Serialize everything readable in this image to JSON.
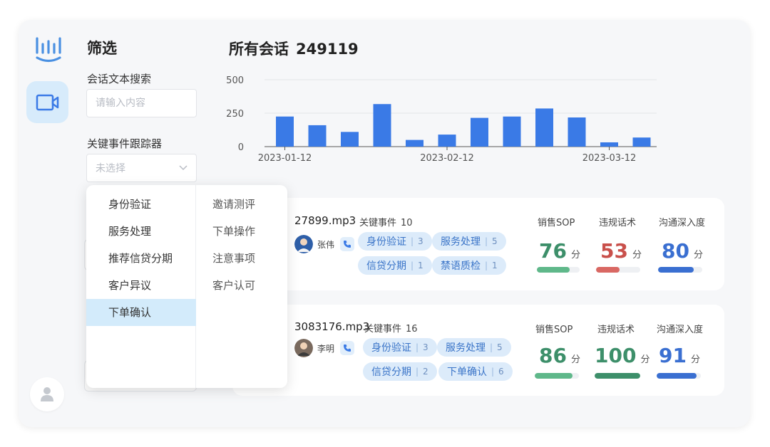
{
  "filter": {
    "title": "筛选",
    "text_search_label": "会话文本搜索",
    "text_search_placeholder": "请输入内容",
    "tracker_label": "关键事件跟踪器",
    "tracker_placeholder": "未选择"
  },
  "dropdown": {
    "col1": [
      "身份验证",
      "服务处理",
      "推荐信贷分期",
      "客户异议",
      "下单确认"
    ],
    "col1_selected": "下单确认",
    "col2": [
      "邀请测评",
      "下单操作",
      "注意事项",
      "客户认可"
    ]
  },
  "main": {
    "title": "所有会话",
    "count": "249119"
  },
  "chart_data": {
    "type": "bar",
    "values": [
      225,
      160,
      110,
      318,
      50,
      90,
      215,
      225,
      285,
      218,
      32,
      68
    ],
    "xticks": [
      "2023-01-12",
      "2023-02-12",
      "2023-03-12"
    ],
    "yticks": [
      "0",
      "250",
      "500"
    ],
    "ylim": [
      0,
      500
    ],
    "bar_color": "#3a7ae6",
    "grid": true
  },
  "cards": [
    {
      "file": "27899.mp3",
      "event_label": "关键事件",
      "event_count": "10",
      "person": "张伟",
      "tags": [
        {
          "label": "身份验证",
          "n": "3"
        },
        {
          "label": "服务处理",
          "n": "5"
        },
        {
          "label": "信贷分期",
          "n": "1"
        },
        {
          "label": "禁语质检",
          "n": "1"
        }
      ],
      "metrics": [
        {
          "name": "销售SOP",
          "score": "76",
          "unit": "分",
          "color": "#3d8f6a",
          "bar": "#5fb88a",
          "pct": 0.76
        },
        {
          "name": "违规话术",
          "score": "53",
          "unit": "分",
          "color": "#c9504b",
          "bar": "#d96863",
          "pct": 0.53
        },
        {
          "name": "沟通深入度",
          "score": "80",
          "unit": "分",
          "color": "#3a6fd1",
          "bar": "#3a6fd1",
          "pct": 0.8
        }
      ]
    },
    {
      "file": "3083176.mp3",
      "event_label": "关键事件",
      "event_count": "16",
      "person": "李明",
      "tags": [
        {
          "label": "身份验证",
          "n": "3"
        },
        {
          "label": "服务处理",
          "n": "5"
        },
        {
          "label": "信贷分期",
          "n": "2"
        },
        {
          "label": "下单确认",
          "n": "6"
        }
      ],
      "metrics": [
        {
          "name": "销售SOP",
          "score": "86",
          "unit": "分",
          "color": "#3d8f6a",
          "bar": "#5fb88a",
          "pct": 0.86
        },
        {
          "name": "违规话术",
          "score": "100",
          "unit": "分",
          "color": "#3d8f6a",
          "bar": "#3d8f6a",
          "pct": 1.0
        },
        {
          "name": "沟通深入度",
          "score": "91",
          "unit": "分",
          "color": "#3a6fd1",
          "bar": "#3a6fd1",
          "pct": 0.91
        }
      ]
    }
  ]
}
